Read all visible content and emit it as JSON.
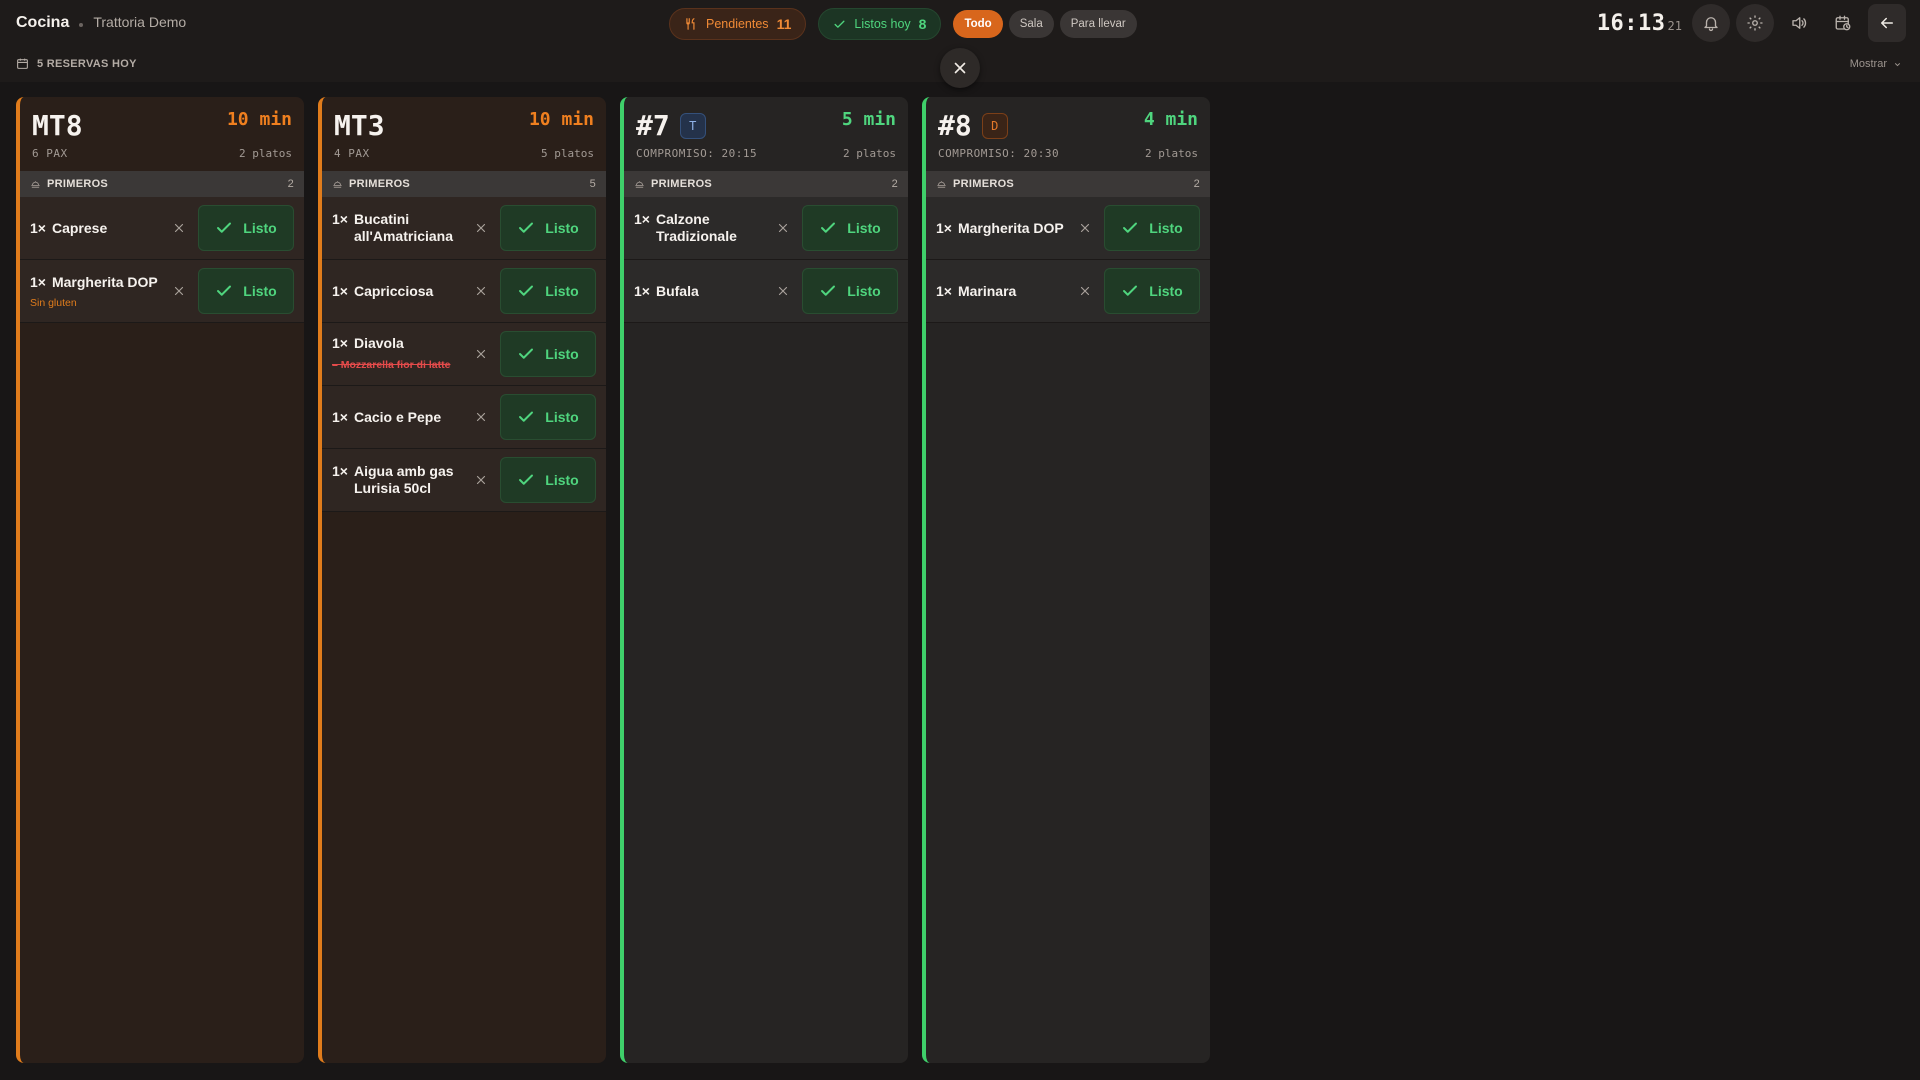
{
  "header": {
    "title": "Cocina",
    "subtitle": "Trattoria Demo",
    "pending_label": "Pendientes",
    "pending_count": "11",
    "ready_label": "Listos hoy",
    "ready_count": "8",
    "filters": [
      "Todo",
      "Sala",
      "Para llevar"
    ],
    "active_filter": "Todo",
    "clock_main": "16:13",
    "clock_seconds": "21"
  },
  "subbar": {
    "reservas": "5 RESERVAS HOY",
    "mostrar": "Mostrar"
  },
  "colors": {
    "accent": "#d8661c",
    "late": "#e07c1c",
    "ok": "#3fcf6a",
    "ready_green": "#4fd57e"
  },
  "listo_label": "Listo",
  "tickets": [
    {
      "id": "MT8",
      "badge": "",
      "status": "late",
      "time": "10 min",
      "meta": "6 PAX",
      "count": "2 platos",
      "section": "PRIMEROS",
      "section_count": "2",
      "items": [
        {
          "qty": "1×",
          "name": "Caprese",
          "mod": "",
          "mod_type": ""
        },
        {
          "qty": "1×",
          "name": "Margherita DOP",
          "mod": "Sin gluten",
          "mod_type": "note"
        }
      ]
    },
    {
      "id": "MT3",
      "badge": "",
      "status": "late",
      "time": "10 min",
      "meta": "4 PAX",
      "count": "5 platos",
      "section": "PRIMEROS",
      "section_count": "5",
      "items": [
        {
          "qty": "1×",
          "name": "Bucatini all'Amatriciana",
          "mod": "",
          "mod_type": ""
        },
        {
          "qty": "1×",
          "name": "Capricciosa",
          "mod": "",
          "mod_type": ""
        },
        {
          "qty": "1×",
          "name": "Diavola",
          "mod": "– Mozzarella fior di latte",
          "mod_type": "removed"
        },
        {
          "qty": "1×",
          "name": "Cacio e Pepe",
          "mod": "",
          "mod_type": ""
        },
        {
          "qty": "1×",
          "name": "Aigua amb gas Lurisia 50cl",
          "mod": "",
          "mod_type": ""
        }
      ]
    },
    {
      "id": "#7",
      "badge": "T",
      "status": "ok",
      "time": "5 min",
      "meta": "COMPROMISO: 20:15",
      "count": "2 platos",
      "section": "PRIMEROS",
      "section_count": "2",
      "items": [
        {
          "qty": "1×",
          "name": "Calzone Tradizionale",
          "mod": "",
          "mod_type": ""
        },
        {
          "qty": "1×",
          "name": "Bufala",
          "mod": "",
          "mod_type": ""
        }
      ]
    },
    {
      "id": "#8",
      "badge": "D",
      "status": "ok",
      "time": "4 min",
      "meta": "COMPROMISO: 20:30",
      "count": "2 platos",
      "section": "PRIMEROS",
      "section_count": "2",
      "items": [
        {
          "qty": "1×",
          "name": "Margherita DOP",
          "mod": "",
          "mod_type": ""
        },
        {
          "qty": "1×",
          "name": "Marinara",
          "mod": "",
          "mod_type": ""
        }
      ]
    }
  ]
}
